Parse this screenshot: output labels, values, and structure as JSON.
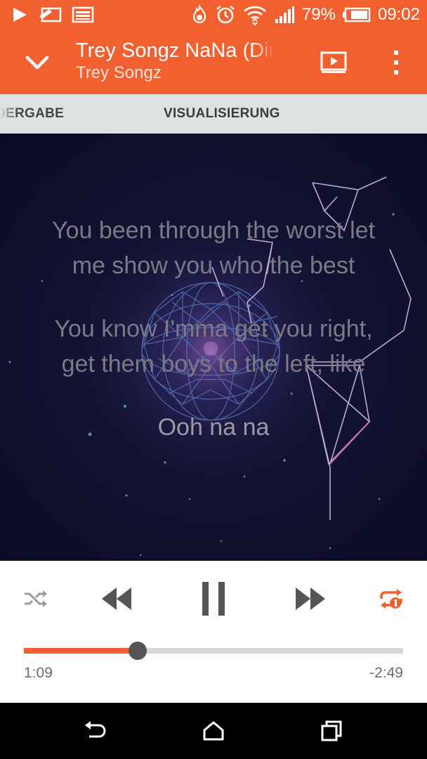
{
  "status_bar": {
    "battery_percent": "79%",
    "time": "09:02",
    "icons": [
      "play-store-icon",
      "messages-icon",
      "gallery-icon",
      "fire-icon",
      "alarm-icon",
      "wifi-icon",
      "signal-icon",
      "battery-icon"
    ]
  },
  "header": {
    "title": "Trey Songz NaNa (Dirty)",
    "artist": "Trey Songz",
    "icons": [
      "chevron-down-icon",
      "cast-icon",
      "more-vert-icon"
    ]
  },
  "tabs": [
    {
      "label": "WIEDERGABE",
      "visible_text": "DERGABE"
    },
    {
      "label": "VISUALISIERUNG"
    }
  ],
  "lyrics": [
    "You been through the worst let",
    "me show you who the best",
    "You know I'mma get you right,",
    "get them boys to the left, like",
    "Ooh na na"
  ],
  "player": {
    "elapsed": "1:09",
    "remaining": "-2:49",
    "progress": 0.3,
    "icons": [
      "shuffle-icon",
      "rewind-icon",
      "pause-icon",
      "fast-forward-icon",
      "repeat-one-icon"
    ]
  },
  "colors": {
    "accent": "#f2602f",
    "visualization_bg": "#131232",
    "lyric_text": "#7b7a86"
  },
  "nav": {
    "icons": [
      "back-icon",
      "home-icon",
      "recents-icon"
    ]
  }
}
